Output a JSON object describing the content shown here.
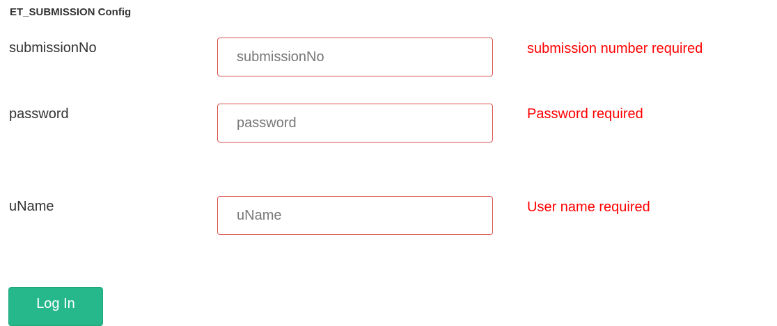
{
  "form": {
    "title": "ET_SUBMISSION Config",
    "fields": [
      {
        "label": "submissionNo",
        "placeholder": "submissionNo",
        "value": "",
        "error": "submission number required"
      },
      {
        "label": "password",
        "placeholder": "password",
        "value": "",
        "error": "Password required"
      },
      {
        "label": "uName",
        "placeholder": "uName",
        "value": "",
        "error": "User name required"
      }
    ],
    "submit_label": "Log In"
  },
  "colors": {
    "error_text": "#ff0000",
    "invalid_border": "#d9534f",
    "submit_background": "#26b88a",
    "submit_text": "#ffffff"
  }
}
